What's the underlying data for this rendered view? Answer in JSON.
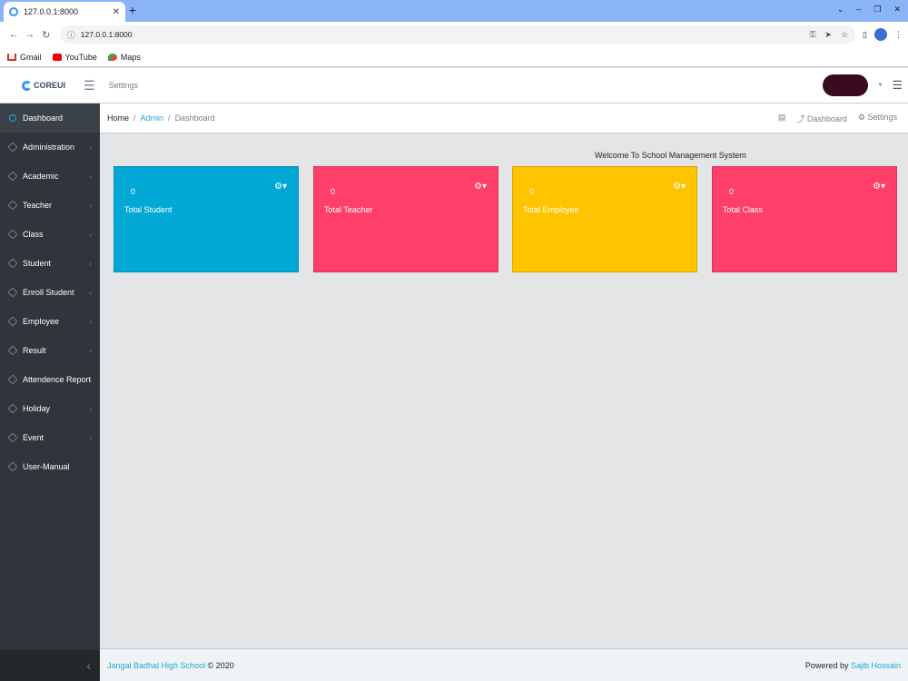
{
  "browser": {
    "tab_title": "127.0.0.1:8000",
    "url": "127.0.0.1:8000",
    "bookmarks": [
      "Gmail",
      "YouTube",
      "Maps"
    ]
  },
  "header": {
    "brand": "COREUI",
    "settings_link": "Settings"
  },
  "sidebar": {
    "items": [
      {
        "label": "Dashboard"
      },
      {
        "label": "Administration"
      },
      {
        "label": "Academic"
      },
      {
        "label": "Teacher"
      },
      {
        "label": "Class"
      },
      {
        "label": "Student"
      },
      {
        "label": "Enroll Student"
      },
      {
        "label": "Employee"
      },
      {
        "label": "Result"
      },
      {
        "label": "Attendence Report"
      },
      {
        "label": "Holiday"
      },
      {
        "label": "Event"
      },
      {
        "label": "User-Manual"
      }
    ]
  },
  "breadcrumb": {
    "home": "Home",
    "admin": "Admin",
    "current": "Dashboard",
    "right_dashboard": "Dashboard",
    "right_settings": "Settings"
  },
  "main": {
    "welcome": "Welcome To School Management System",
    "cards": [
      {
        "value": "0",
        "label": "Total Student",
        "color": "#03a9d6"
      },
      {
        "value": "0",
        "label": "Total Teacher",
        "color": "#ff3f6a"
      },
      {
        "value": "0",
        "label": "Total Employee",
        "color": "#ffc400"
      },
      {
        "value": "0",
        "label": "Total Class",
        "color": "#ff3f6a"
      }
    ]
  },
  "footer": {
    "school": "Jangal Badhal High School",
    "copyright": "© 2020",
    "powered_by": "Powered by",
    "author": "Sajib Hossain"
  }
}
